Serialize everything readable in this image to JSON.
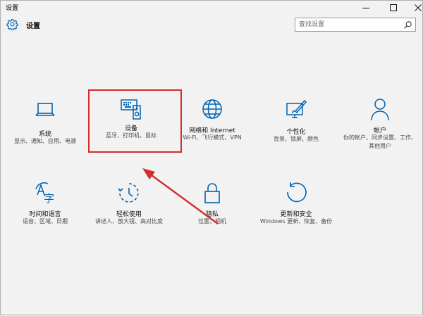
{
  "window": {
    "title": "设置",
    "controls": [
      "minimize-icon",
      "maximize-icon",
      "close-icon"
    ]
  },
  "header": {
    "title": "设置",
    "icon": "gear-icon"
  },
  "search": {
    "placeholder": "查找设置",
    "value": "",
    "icon": "search-icon"
  },
  "categories": [
    {
      "label": "系统",
      "desc": "显示、通知、应用、电源",
      "icon": "laptop-icon"
    },
    {
      "label": "设备",
      "desc": "蓝牙、打印机、鼠标",
      "icon": "devices-icon"
    },
    {
      "label": "网络和 Internet",
      "desc": "Wi-Fi、飞行模式、VPN",
      "icon": "globe-icon"
    },
    {
      "label": "个性化",
      "desc": "背景、锁屏、颜色",
      "icon": "personalization-icon"
    },
    {
      "label": "帐户",
      "desc": "你的帐户、同步设置、工作、其他用户",
      "icon": "person-icon"
    },
    {
      "label": "时间和语言",
      "desc": "语音、区域、日期",
      "icon": "time-language-icon"
    },
    {
      "label": "轻松使用",
      "desc": "讲述人、放大镜、高对比度",
      "icon": "ease-of-access-icon"
    },
    {
      "label": "隐私",
      "desc": "位置、相机",
      "icon": "lock-icon"
    },
    {
      "label": "更新和安全",
      "desc": "Windows 更新、恢复、备份",
      "icon": "update-icon"
    }
  ],
  "annotation": {
    "highlight_color": "#d42c2c",
    "highlighted_category": "设备"
  },
  "colors": {
    "accent": "#0063b1",
    "background": "#f2f2f2",
    "annotation": "#d42c2c"
  }
}
